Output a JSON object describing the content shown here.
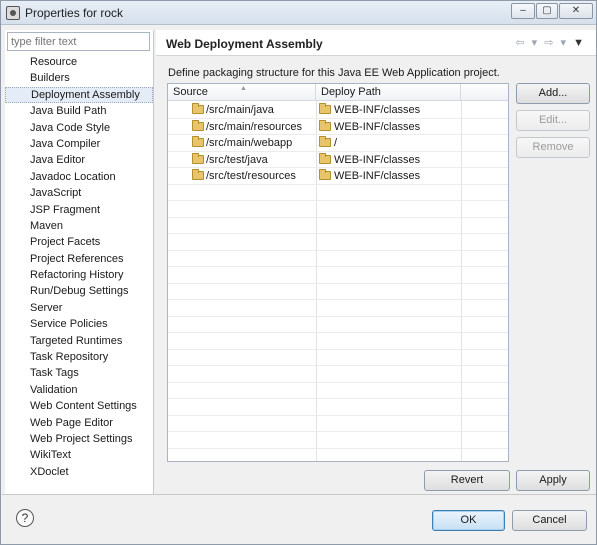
{
  "window": {
    "title": "Properties for rock",
    "minimize_glyph": "‒",
    "maximize_glyph": "▢",
    "close_glyph": "✕"
  },
  "sidebar": {
    "filter_placeholder": "type filter text",
    "items": [
      {
        "label": "Resource"
      },
      {
        "label": "Builders"
      },
      {
        "label": "Deployment Assembly",
        "selected": true
      },
      {
        "label": "Java Build Path"
      },
      {
        "label": "Java Code Style"
      },
      {
        "label": "Java Compiler"
      },
      {
        "label": "Java Editor"
      },
      {
        "label": "Javadoc Location"
      },
      {
        "label": "JavaScript"
      },
      {
        "label": "JSP Fragment"
      },
      {
        "label": "Maven"
      },
      {
        "label": "Project Facets"
      },
      {
        "label": "Project References"
      },
      {
        "label": "Refactoring History"
      },
      {
        "label": "Run/Debug Settings"
      },
      {
        "label": "Server"
      },
      {
        "label": "Service Policies"
      },
      {
        "label": "Targeted Runtimes"
      },
      {
        "label": "Task Repository"
      },
      {
        "label": "Task Tags"
      },
      {
        "label": "Validation"
      },
      {
        "label": "Web Content Settings"
      },
      {
        "label": "Web Page Editor"
      },
      {
        "label": "Web Project Settings"
      },
      {
        "label": "WikiText"
      },
      {
        "label": "XDoclet"
      }
    ]
  },
  "page": {
    "title": "Web Deployment Assembly",
    "nav_back": "⇦",
    "nav_forward": "⇨",
    "nav_dropdown": "▾",
    "nav_menu": "▼",
    "description": "Define packaging structure for this Java EE Web Application project."
  },
  "table": {
    "columns": [
      "Source",
      "Deploy Path"
    ],
    "rows": [
      {
        "source": "/src/main/java",
        "deploy": "WEB-INF/classes"
      },
      {
        "source": "/src/main/resources",
        "deploy": "WEB-INF/classes"
      },
      {
        "source": "/src/main/webapp",
        "deploy": "/"
      },
      {
        "source": "/src/test/java",
        "deploy": "WEB-INF/classes"
      },
      {
        "source": "/src/test/resources",
        "deploy": "WEB-INF/classes"
      }
    ]
  },
  "buttons": {
    "add": "Add...",
    "edit": "Edit...",
    "remove": "Remove",
    "revert": "Revert",
    "apply": "Apply",
    "ok": "OK",
    "cancel": "Cancel",
    "help": "?"
  }
}
